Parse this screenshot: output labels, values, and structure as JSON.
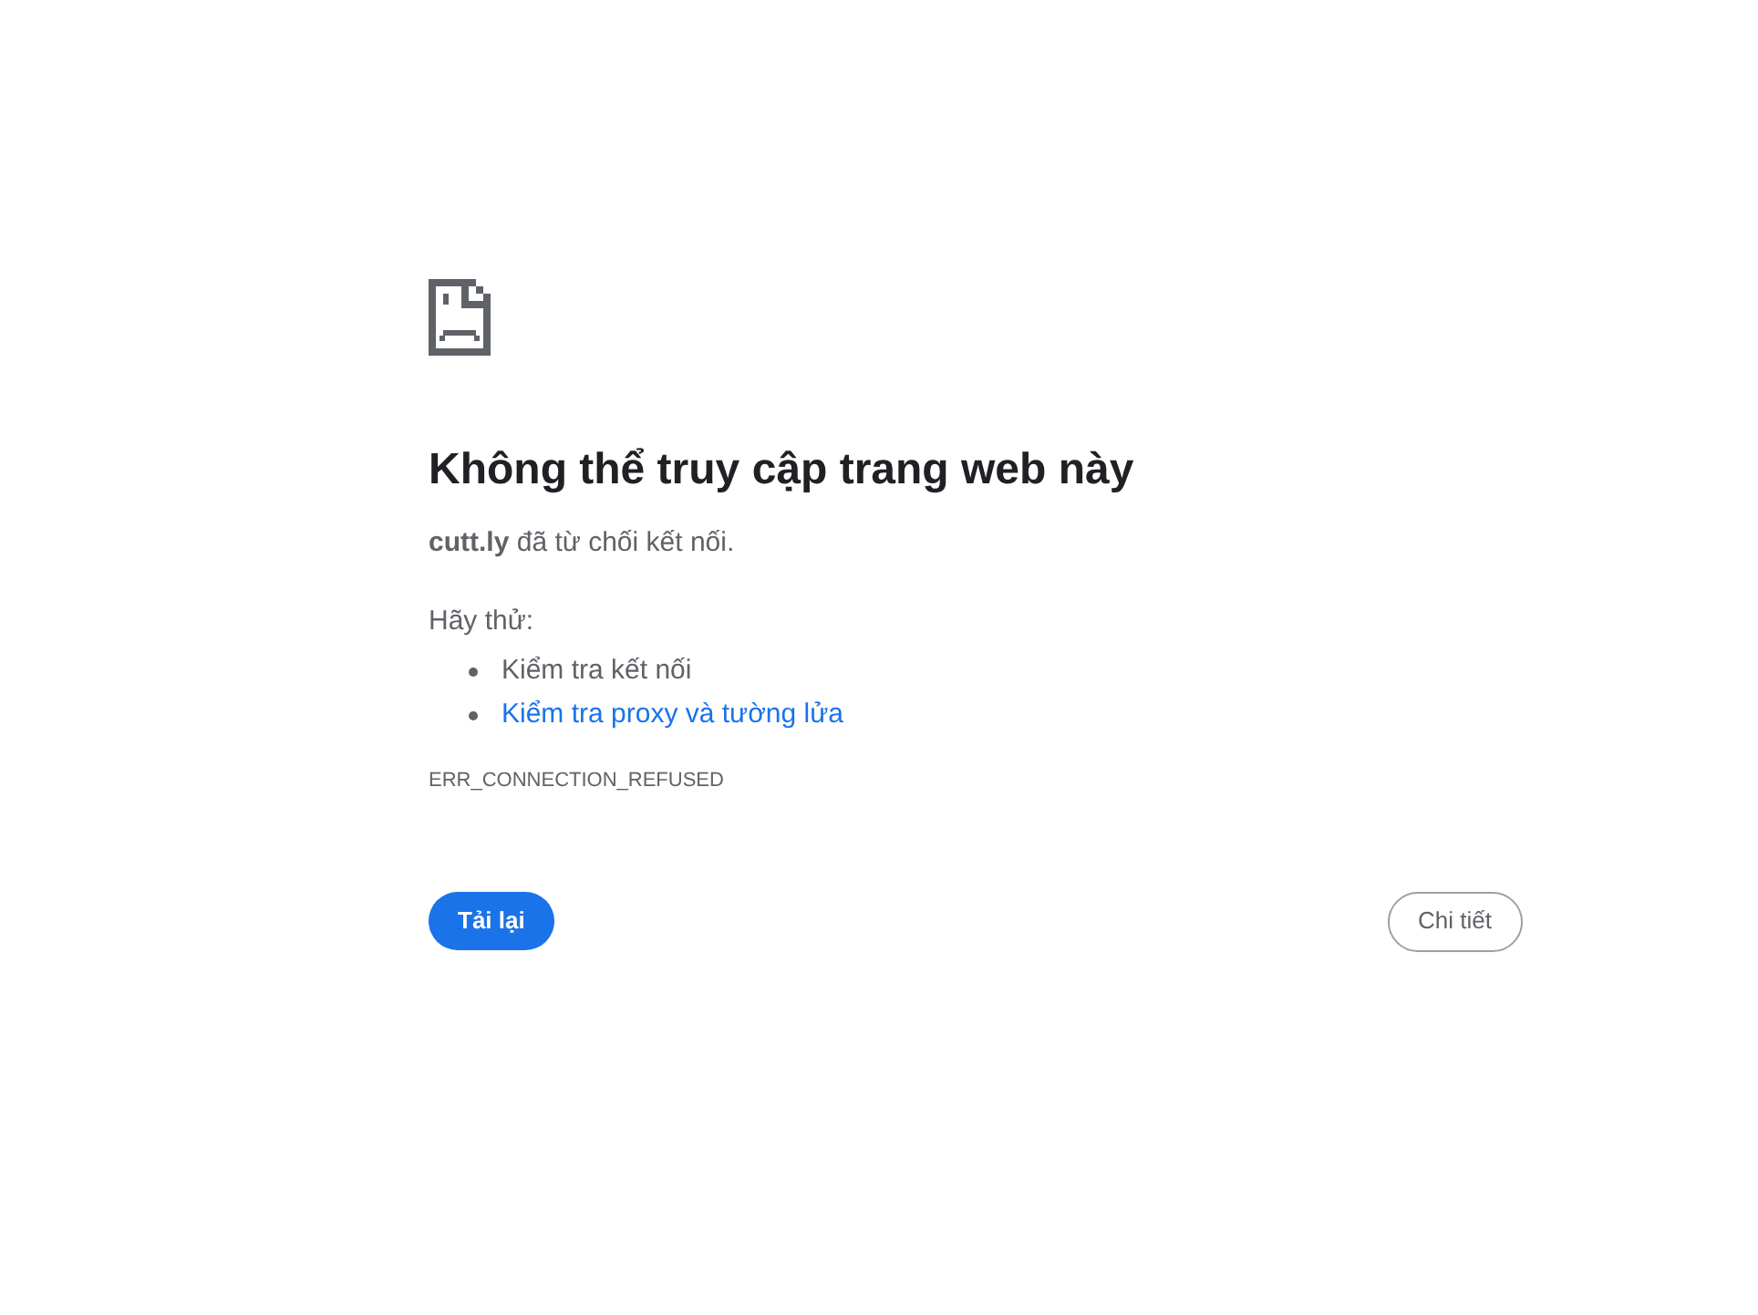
{
  "heading": "Không thể truy cập trang web này",
  "message": "**cutt.ly** đã từ chối kết nối.",
  "suggestions_title": "Hãy thử:",
  "suggestions": [
    {
      "kind": "text",
      "label": "Kiểm tra kết nối"
    },
    {
      "kind": "link",
      "label": "Kiểm tra proxy và tường lửa"
    }
  ],
  "error_code": "ERR_CONNECTION_REFUSED",
  "buttons": [
    {
      "kind": "primary",
      "label": "Tải lại"
    },
    {
      "kind": "secondary",
      "label": "Chi tiết"
    }
  ]
}
